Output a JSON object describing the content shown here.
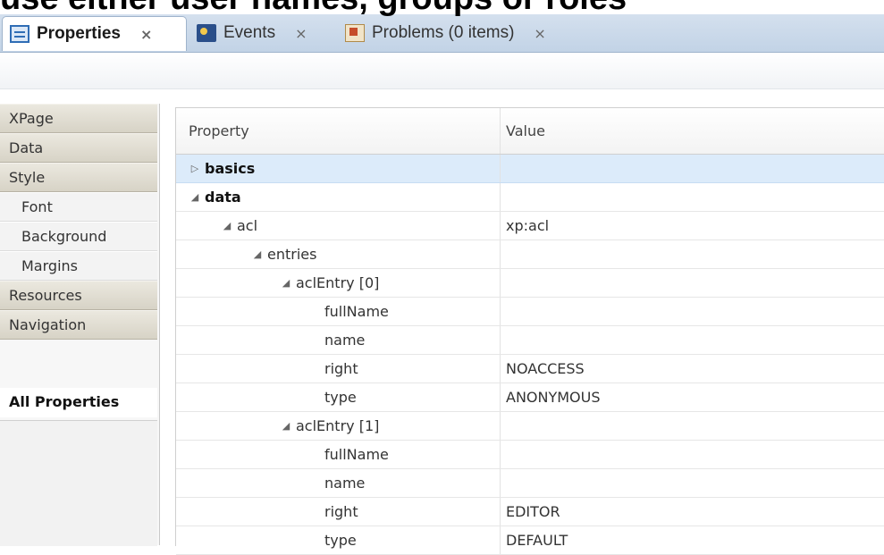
{
  "caption": "use either user names, groups or roles",
  "tabs": [
    {
      "label": "Properties",
      "icon": "properties-icon",
      "active": true
    },
    {
      "label": "Events",
      "icon": "events-icon",
      "active": false
    },
    {
      "label": "Problems (0 items)",
      "icon": "problems-icon",
      "active": false
    }
  ],
  "close_glyph": "×",
  "expand_glyphs": {
    "collapsed": "▷",
    "expanded": "◢"
  },
  "sidebar": {
    "items": [
      {
        "label": "XPage"
      },
      {
        "label": "Data"
      },
      {
        "label": "Style"
      },
      {
        "label": "Font"
      },
      {
        "label": "Background"
      },
      {
        "label": "Margins"
      },
      {
        "label": "Resources"
      },
      {
        "label": "Navigation"
      },
      {
        "label": "All Properties"
      }
    ]
  },
  "grid": {
    "columns": {
      "property": "Property",
      "value": "Value"
    },
    "rows": [
      {
        "property": "basics",
        "value": ""
      },
      {
        "property": "data",
        "value": ""
      },
      {
        "property": "acl",
        "value": "xp:acl"
      },
      {
        "property": "entries",
        "value": ""
      },
      {
        "property": "aclEntry [0]",
        "value": ""
      },
      {
        "property": "fullName",
        "value": ""
      },
      {
        "property": "name",
        "value": ""
      },
      {
        "property": "right",
        "value": "NOACCESS"
      },
      {
        "property": "type",
        "value": "ANONYMOUS"
      },
      {
        "property": "aclEntry [1]",
        "value": ""
      },
      {
        "property": "fullName",
        "value": ""
      },
      {
        "property": "name",
        "value": ""
      },
      {
        "property": "right",
        "value": "EDITOR"
      },
      {
        "property": "type",
        "value": "DEFAULT"
      }
    ]
  },
  "colors": {
    "tabbar": "#c8d8ea",
    "selected_row": "#dcebfa",
    "sidebar_item": "#e1ddd1"
  }
}
